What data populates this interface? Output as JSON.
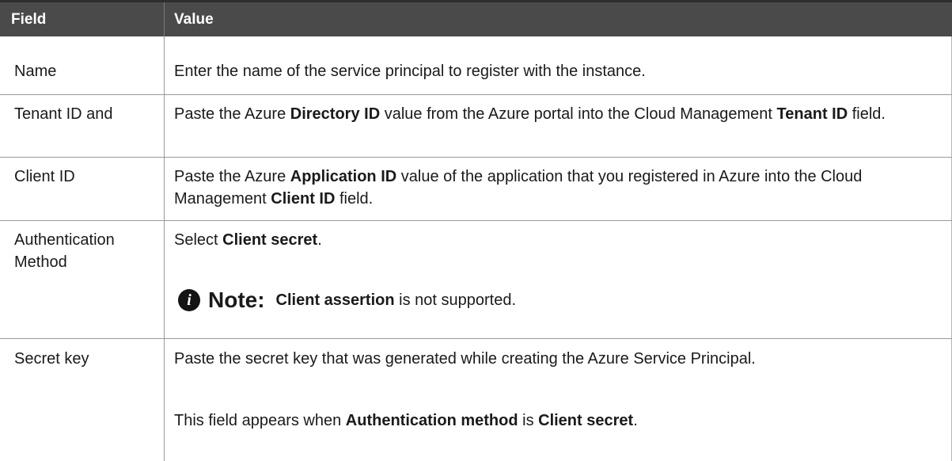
{
  "header": {
    "field": "Field",
    "value": "Value"
  },
  "rows": [
    {
      "field": "Name",
      "value": [
        "Enter the name of the service principal to register with the instance."
      ]
    },
    {
      "field": "Tenant ID and",
      "value": [
        "Paste the Azure ",
        "Directory ID",
        " value from the Azure portal into the Cloud Management ",
        "Tenant ID",
        " field."
      ]
    },
    {
      "field": "Client ID",
      "value": [
        "Paste the Azure ",
        "Application ID",
        " value of the application that you registered in Azure into the Cloud Management ",
        "Client ID",
        " field."
      ]
    },
    {
      "field_line1": "Authentication",
      "field_line2": "Method",
      "value": [
        "Select ",
        "Client secret",
        "."
      ],
      "note": {
        "icon": "info-icon",
        "icon_glyph": "i",
        "label": "Note:",
        "bold": "Client assertion",
        "text": " is not supported."
      }
    },
    {
      "field": "Secret key",
      "value": [
        "Paste the secret key that was generated while creating the Azure Service Principal."
      ],
      "value2": [
        "This field appears when ",
        "Authentication method",
        " is ",
        "Client secret",
        "."
      ]
    }
  ]
}
